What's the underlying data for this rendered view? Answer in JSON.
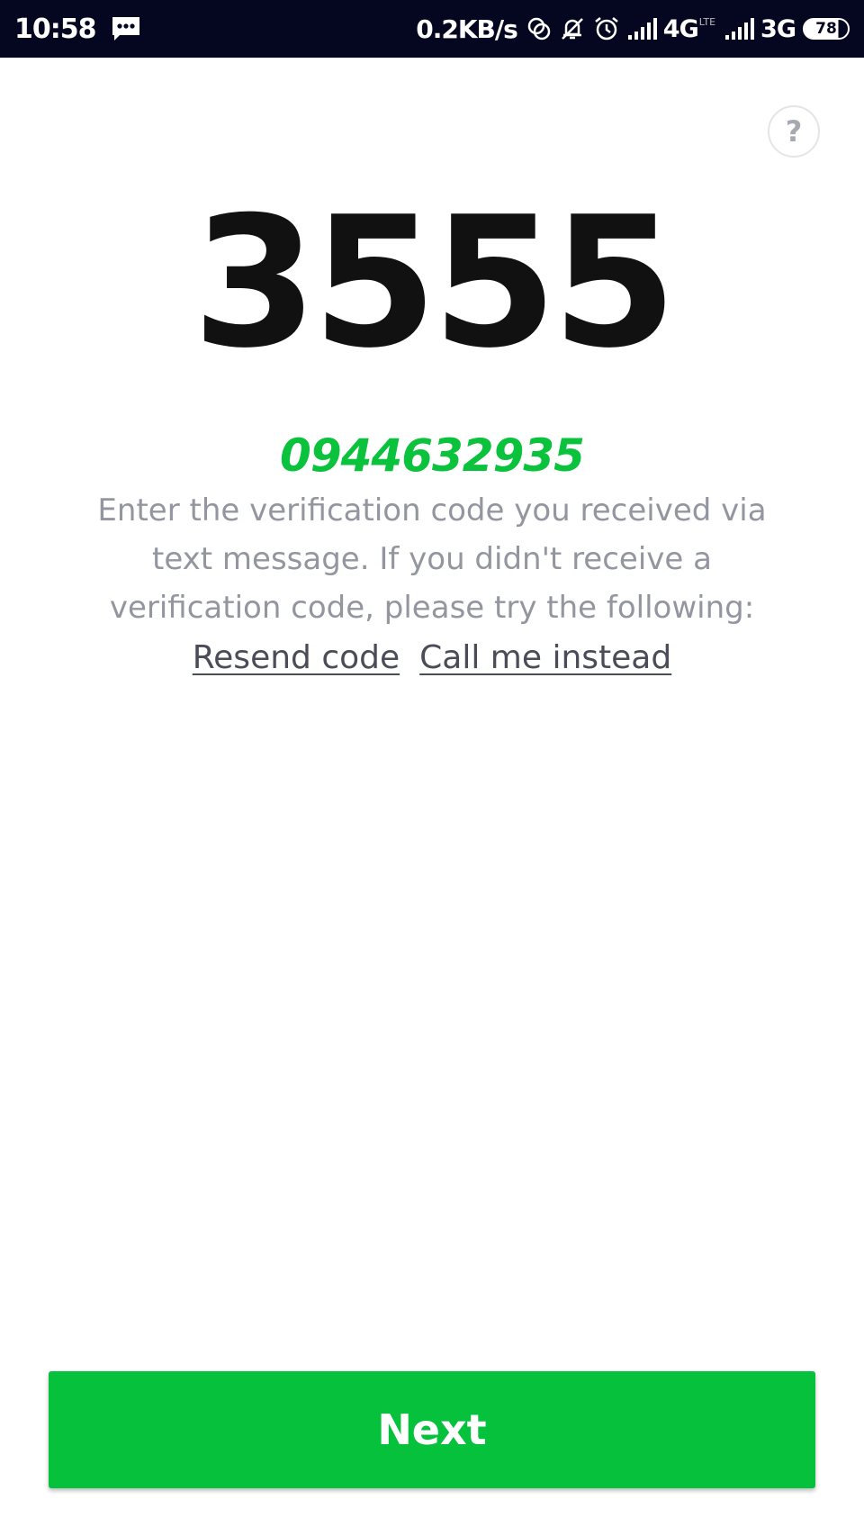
{
  "status_bar": {
    "time": "10:58",
    "speed": "0.2KB/s",
    "network1": "4G",
    "network1_sub": "LTE",
    "network2": "3G",
    "battery": "78",
    "icons": [
      "message-icon",
      "sync-icon",
      "mute-icon",
      "alarm-icon",
      "signal-icon",
      "signal-icon"
    ]
  },
  "help": {
    "label": "?"
  },
  "verification": {
    "code": "3555",
    "phone_number": "0944632935",
    "instructions": "Enter the verification code you received via text message. If you didn't receive a verification code, please try the following:",
    "resend_label": "Resend code",
    "call_label": "Call me instead"
  },
  "next_button": {
    "label": "Next"
  },
  "colors": {
    "accent_green": "#06c13c",
    "status_bar_bg": "#05061f",
    "text_gray": "#93969f",
    "link_dark": "#4a4c57"
  }
}
